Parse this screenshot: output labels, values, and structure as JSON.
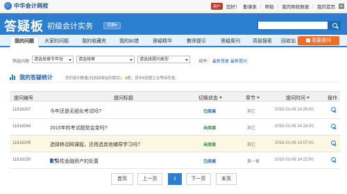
{
  "site": {
    "name": "中华会计网校"
  },
  "top_bar": {
    "user_greeting": "您好！",
    "links": [
      "勤课表",
      "帮助",
      "我的网校数据",
      "我的首页"
    ],
    "user_badge": "用户"
  },
  "header": {
    "brand": "答疑板",
    "course": "初级会计实务",
    "switch_label": "切换",
    "search_placeholder": ""
  },
  "nav": {
    "items": [
      "我的问题",
      "大家的问题",
      "我的收藏夹",
      "我的纠错",
      "答疑精华",
      "教师提示",
      "答疑周刊",
      "高级搜索",
      "回收站"
    ],
    "active_index": 0,
    "ask_button": "我要提问"
  },
  "filters": {
    "label": "筛选问题",
    "select_chapter_year": "请选择章节年份",
    "select_chapter": "请选择章",
    "select_type": "请选择提问类型",
    "sort_label": "排序：",
    "sort_links": [
      "最新答复",
      "最新提问"
    ]
  },
  "stats": {
    "title": "我的答疑统计",
    "text_pre": "您的提问数量(包括回收站的题目)：",
    "count": "4",
    "text_mid": "题，其中",
    "pending": "0",
    "text_post": "道题正在等待答复。"
  },
  "table": {
    "headers": [
      "提问编号",
      "提问标题",
      "切换状态",
      "章节",
      "提问时间",
      "操作"
    ],
    "rows": [
      {
        "id": "11618267",
        "title": "今年还是无纸化考试吗?",
        "status": "已阅读",
        "status_type": "read",
        "chapter": "其它",
        "time": "2015-01-06 14:26:00",
        "highlight": false,
        "icons": false
      },
      {
        "id": "11618264",
        "title": "2015年的考试题型会变吗?",
        "status": "未阅读",
        "status_type": "unread",
        "chapter": "其它",
        "time": "2015-01-06 14:24:00",
        "highlight": false,
        "icons": false
      },
      {
        "id": "11618209",
        "title": "选择移动网课程，还用选其他辅导学习吗?",
        "status": "未阅读",
        "status_type": "unread",
        "chapter": "其它",
        "time": "2015-01-06 14:07:00",
        "highlight": true,
        "icons": false
      },
      {
        "id": "11618150",
        "title": "交易性金融资产的处置",
        "status": "已阅读",
        "status_type": "read",
        "chapter": "第一章",
        "time": "2015-01-06 14:22:00",
        "highlight": false,
        "icons": true
      }
    ]
  },
  "pager": {
    "first": "首页",
    "prev": "上一页",
    "current": "1",
    "next": "下一页",
    "last": "末页"
  },
  "colors": {
    "primary": "#2b7fd1",
    "accent": "#f26c24",
    "read": "#1a5fb4",
    "unread": "#2b8a3e"
  }
}
